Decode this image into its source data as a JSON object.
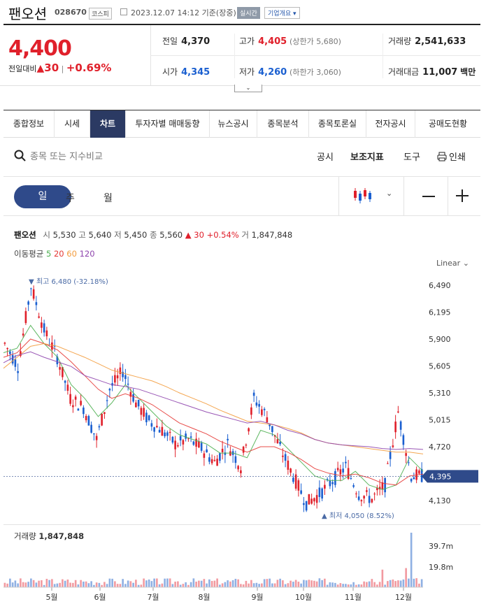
{
  "header": {
    "stock_name": "팬오션",
    "stock_code": "028670",
    "market_badge": "코스피",
    "timestamp": "2023.12.07 14:12 기준(장중)",
    "live_badge": "실시간",
    "company_button": "기업개요"
  },
  "summary": {
    "price": "4,400",
    "change_label": "전일대비",
    "change_value": "30",
    "change_pct": "+0.69%",
    "prev_close_label": "전일",
    "prev_close": "4,370",
    "high_label": "고가",
    "high": "4,405",
    "upper_limit": "(상한가 5,680)",
    "volume_label": "거래량",
    "volume": "2,541,633",
    "open_label": "시가",
    "open": "4,345",
    "low_label": "저가",
    "low": "4,260",
    "lower_limit": "(하한가 3,060)",
    "amount_label": "거래대금",
    "amount": "11,007",
    "amount_unit": "백만"
  },
  "tabs": [
    "종합정보",
    "시세",
    "차트",
    "투자자별 매매동향",
    "뉴스공시",
    "종목분석",
    "종목토론실",
    "전자공시",
    "공매도현황"
  ],
  "active_tab": "차트",
  "toolbar": {
    "search_placeholder": "종목 또는 지수비교",
    "disclosure": "공시",
    "indicators": "보조지표",
    "tools": "도구",
    "print": "인쇄"
  },
  "periods": {
    "day": "일",
    "week": "주",
    "month": "월"
  },
  "chart_info": {
    "name": "팬오션",
    "open_label": "시",
    "open": "5,530",
    "high_label": "고",
    "high": "5,640",
    "low_label": "저",
    "low": "5,450",
    "close_label": "종",
    "close": "5,560",
    "change": "▲ 30 +0.54%",
    "volume_label": "거",
    "volume": "1,847,848",
    "ma_label": "이동평균",
    "ma": [
      {
        "period": "5",
        "color": "#4caf50"
      },
      {
        "period": "20",
        "color": "#e53935"
      },
      {
        "period": "60",
        "color": "#f39c3d"
      },
      {
        "period": "120",
        "color": "#8e44ad"
      }
    ],
    "scale": "Linear",
    "max_label": "▼ 최고 6,480 (-32.18%)",
    "min_label": "▲ 최저 4,050 (8.52%)",
    "current_price": "4,395",
    "volume_title": "거래량",
    "volume_value": "1,847,848"
  },
  "chart_data": {
    "type": "line",
    "title": "",
    "y_ticks": [
      6490,
      6195,
      5900,
      5605,
      5310,
      5015,
      4720,
      4130
    ],
    "x_ticks": [
      "5월",
      "6월",
      "7월",
      "8월",
      "9월",
      "10월",
      "11월",
      "12월"
    ],
    "volume_ticks": [
      "39.7m",
      "19.8m"
    ],
    "ylim": [
      4050,
      6480
    ],
    "series": [
      {
        "values": [
          5850,
          5600,
          6480,
          6000,
          5700,
          5250,
          5150,
          4800,
          5350,
          5550,
          5200,
          5000,
          4900,
          4750,
          4800,
          4700,
          4550,
          4750,
          4500,
          5250,
          5050,
          4700,
          4400,
          4100,
          4200,
          4350,
          4500,
          4200,
          4150,
          4300,
          5100,
          4400
        ]
      },
      {
        "values": [
          5750,
          5800,
          6050,
          5850,
          5700,
          5400,
          5250,
          5050,
          5200,
          5400,
          5250,
          5100,
          4950,
          4850,
          4800,
          4750,
          4650,
          4650,
          4600,
          4900,
          4850,
          4700,
          4550,
          4400,
          4350,
          4350,
          4450,
          4300,
          4250,
          4300,
          4600,
          4450
        ]
      },
      {
        "values": [
          5700,
          5750,
          5900,
          5850,
          5780,
          5650,
          5500,
          5350,
          5250,
          5300,
          5250,
          5180,
          5080,
          4980,
          4920,
          4860,
          4780,
          4720,
          4660,
          4720,
          4720,
          4660,
          4580,
          4480,
          4430,
          4400,
          4420,
          4380,
          4320,
          4300,
          4400,
          4420
        ]
      },
      {
        "values": [
          5580,
          5700,
          5820,
          5850,
          5820,
          5760,
          5700,
          5630,
          5560,
          5520,
          5480,
          5440,
          5380,
          5310,
          5250,
          5190,
          5120,
          5060,
          5000,
          4980,
          4960,
          4920,
          4870,
          4800,
          4760,
          4740,
          4720,
          4700,
          4680,
          4660,
          4660,
          4640
        ]
      },
      {
        "values": [
          5640,
          5720,
          5760,
          5700,
          5650,
          5600,
          5500,
          5450,
          5400,
          5380,
          5350,
          5300,
          5250,
          5200,
          5150,
          5100,
          5060,
          5020,
          4980,
          5000,
          4960,
          4900,
          4860,
          4800,
          4760,
          4740,
          4730,
          4720,
          4700,
          4690,
          4700,
          4690
        ]
      }
    ]
  },
  "colors": {
    "up": "#e0202b",
    "down": "#1a5fd0",
    "tab_active": "#2b3a63",
    "period_active": "#2f4a8a"
  }
}
